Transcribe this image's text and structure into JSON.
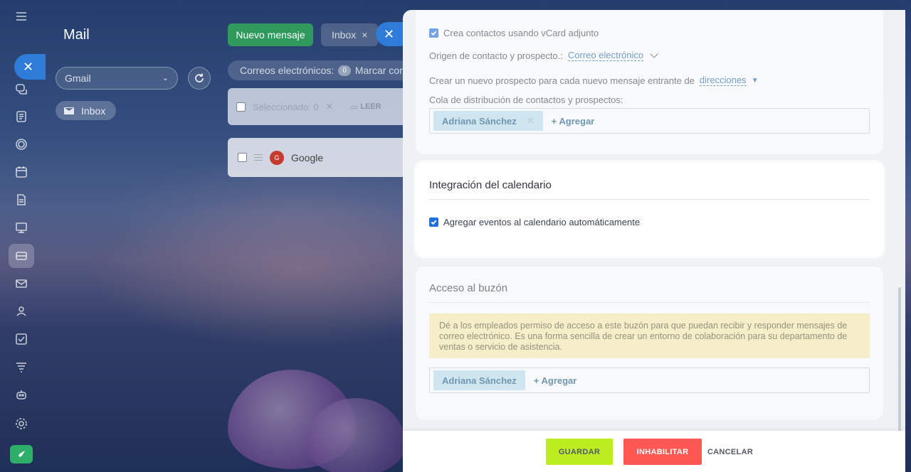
{
  "mail": {
    "title": "Mail",
    "mailbox_select": "Gmail",
    "inbox_filter": "Inbox",
    "new_message": "Nuevo mensaje",
    "inbox_tab": "Inbox",
    "emails_label": "Correos electrónicos:",
    "emails_count": "0",
    "mark_label": "Marcar cor",
    "selected_label": "Seleccionado: 0",
    "read_label": "LEER",
    "sender_initial": "G",
    "sender_name": "Google"
  },
  "panel": {
    "crm": {
      "vcard_label": "Crea contactos usando vCard adjunto",
      "vcard_checked": true,
      "origin_label": "Origen de contacto y prospecto.:",
      "origin_value": "Correo electrónico",
      "new_lead_label": "Crear un nuevo prospecto para cada nuevo mensaje entrante de",
      "new_lead_value": "direcciones",
      "queue_label": "Cola de distribución de contactos y prospectos:",
      "queue_user": "Adriana Sánchez",
      "queue_add": "+ Agregar"
    },
    "calendar": {
      "title": "Integración del calendario",
      "auto_events_label": "Agregar eventos al calendario automáticamente",
      "auto_events_checked": true
    },
    "access": {
      "title": "Acceso al buzón",
      "notice": "Dé a los empleados permiso de acceso a este buzón para que puedan recibir y responder mensajes de correo electrónico. Es una forma sencilla de crear un entorno de colaboración para su departamento de ventas o servicio de asistencia.",
      "user": "Adriana Sánchez",
      "add": "+ Agregar"
    },
    "footer": {
      "save": "GUARDAR",
      "disable": "INHABILITAR",
      "cancel": "CANCELAR"
    }
  },
  "colors": {
    "accent_blue": "#2f7bd8",
    "save_green": "#bbed21",
    "disable_red": "#ff5752",
    "notice_yellow": "#fbedab",
    "user_tag": "#bcdff0"
  }
}
